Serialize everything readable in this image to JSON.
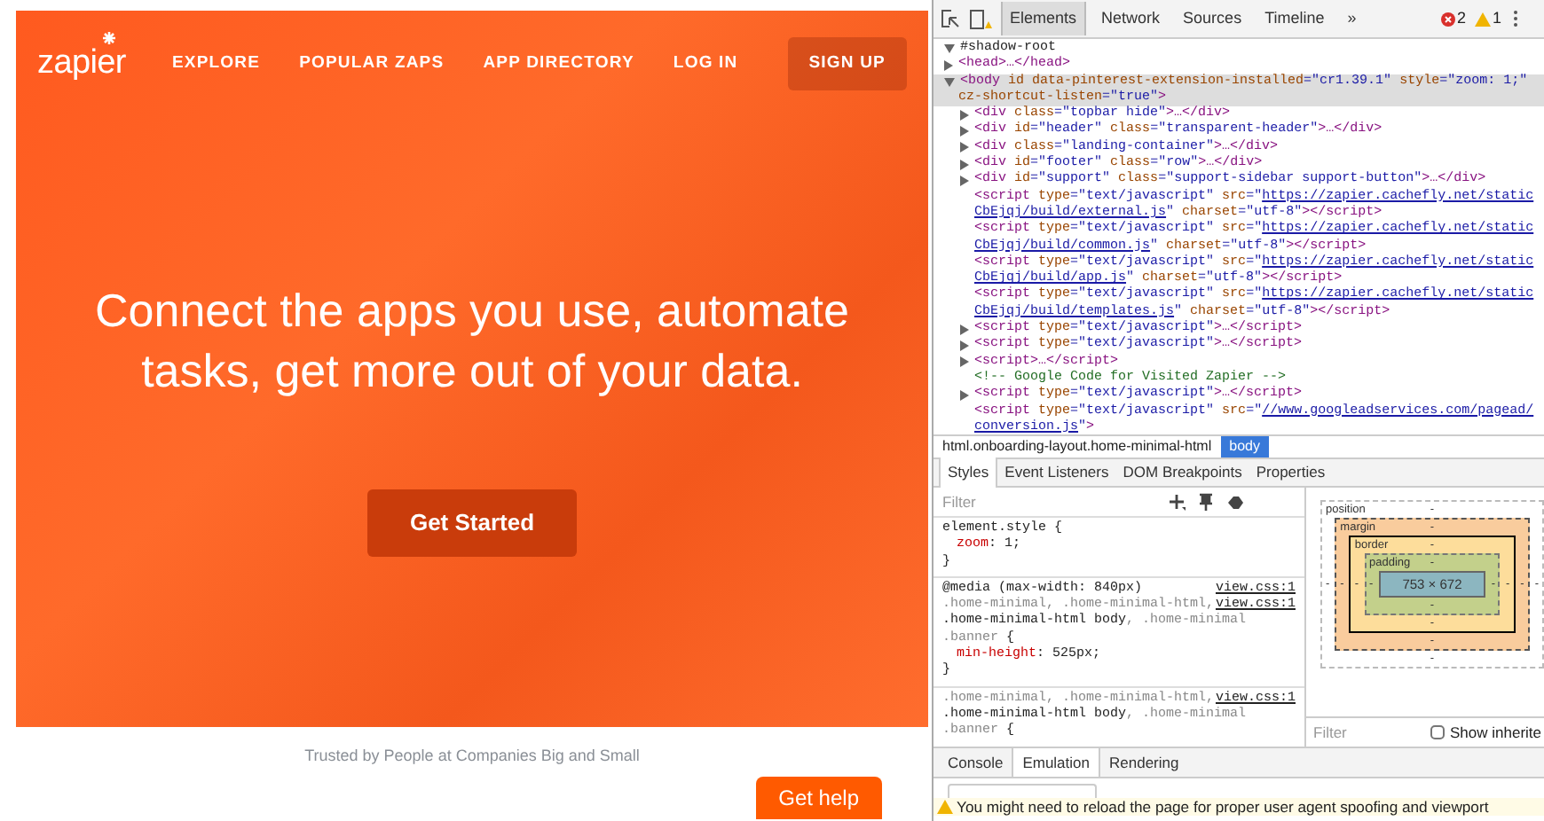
{
  "page": {
    "logo": "zapier",
    "nav": [
      {
        "label": "EXPLORE",
        "kind": "link"
      },
      {
        "label": "POPULAR ZAPS",
        "kind": "link"
      },
      {
        "label": "APP DIRECTORY",
        "kind": "link"
      },
      {
        "label": "LOG IN",
        "kind": "link"
      },
      {
        "label": "SIGN UP",
        "kind": "button"
      }
    ],
    "headline": "Connect the apps you use, automate tasks, get more out of your data.",
    "cta": "Get Started",
    "tagline": "Trusted by People at Companies Big and Small",
    "help_button": "Get help"
  },
  "devtools": {
    "toolbar": {
      "tabs": [
        {
          "label": "Elements",
          "selected": true
        },
        {
          "label": "Network",
          "selected": false
        },
        {
          "label": "Sources",
          "selected": false
        },
        {
          "label": "Timeline",
          "selected": false
        }
      ],
      "more": "»",
      "errors": "2",
      "warnings": "1"
    },
    "dom": [
      {
        "expanded": true,
        "selected": false,
        "lines": [
          [
            {
              "kind": "plain",
              "text": "#shadow-root"
            }
          ]
        ]
      },
      {
        "expanded": false,
        "selected": false,
        "lines": [
          [
            {
              "kind": "tag",
              "text": "<head>…</head>"
            }
          ]
        ]
      },
      {
        "expanded": true,
        "selected": true,
        "lines": [
          [
            {
              "kind": "tag",
              "text": "<body"
            },
            {
              "kind": "attr",
              "text": " id data-pinterest-extension-installed"
            },
            {
              "kind": "value",
              "text": "=\"cr1.39.1\""
            },
            {
              "kind": "attr",
              "text": " style"
            },
            {
              "kind": "value",
              "text": "=\"zoom: 1;\""
            }
          ],
          [
            {
              "kind": "attr",
              "text": "cz-shortcut-listen"
            },
            {
              "kind": "value",
              "text": "=\"true\""
            },
            {
              "kind": "tag",
              "text": ">"
            }
          ]
        ],
        "children": [
          {
            "expanded": false,
            "selected": false,
            "lines": [
              [
                {
                  "kind": "tag",
                  "text": "<div"
                },
                {
                  "kind": "attr",
                  "text": " class"
                },
                {
                  "kind": "value",
                  "text": "=\"topbar hide\""
                },
                {
                  "kind": "tag",
                  "text": ">…</div>"
                }
              ]
            ]
          },
          {
            "expanded": false,
            "selected": false,
            "lines": [
              [
                {
                  "kind": "tag",
                  "text": "<div"
                },
                {
                  "kind": "attr",
                  "text": " id"
                },
                {
                  "kind": "value",
                  "text": "=\"header\""
                },
                {
                  "kind": "attr",
                  "text": " class"
                },
                {
                  "kind": "value",
                  "text": "=\"transparent-header\""
                },
                {
                  "kind": "tag",
                  "text": ">…</div>"
                }
              ]
            ]
          },
          {
            "expanded": false,
            "selected": false,
            "lines": [
              [
                {
                  "kind": "tag",
                  "text": "<div"
                },
                {
                  "kind": "attr",
                  "text": " class"
                },
                {
                  "kind": "value",
                  "text": "=\"landing-container\""
                },
                {
                  "kind": "tag",
                  "text": ">…</div>"
                }
              ]
            ]
          },
          {
            "expanded": false,
            "selected": false,
            "lines": [
              [
                {
                  "kind": "tag",
                  "text": "<div"
                },
                {
                  "kind": "attr",
                  "text": " id"
                },
                {
                  "kind": "value",
                  "text": "=\"footer\""
                },
                {
                  "kind": "attr",
                  "text": " class"
                },
                {
                  "kind": "value",
                  "text": "=\"row\""
                },
                {
                  "kind": "tag",
                  "text": ">…</div>"
                }
              ]
            ]
          },
          {
            "expanded": false,
            "selected": false,
            "lines": [
              [
                {
                  "kind": "tag",
                  "text": "<div"
                },
                {
                  "kind": "attr",
                  "text": " id"
                },
                {
                  "kind": "value",
                  "text": "=\"support\""
                },
                {
                  "kind": "attr",
                  "text": " class"
                },
                {
                  "kind": "value",
                  "text": "=\"support-sidebar support-button\""
                },
                {
                  "kind": "tag",
                  "text": ">…</div>"
                }
              ]
            ]
          },
          {
            "selected": false,
            "lines": [
              [
                {
                  "kind": "tag",
                  "text": "<script"
                },
                {
                  "kind": "attr",
                  "text": " type"
                },
                {
                  "kind": "value",
                  "text": "=\"text/javascript\""
                },
                {
                  "kind": "attr",
                  "text": " src"
                },
                {
                  "kind": "value",
                  "text": "=\""
                },
                {
                  "kind": "link",
                  "text": "https://zapier.cachefly.net/static"
                }
              ],
              [
                {
                  "kind": "link",
                  "text": "CbEjqj/build/external.js"
                },
                {
                  "kind": "value",
                  "text": "\""
                },
                {
                  "kind": "attr",
                  "text": " charset"
                },
                {
                  "kind": "value",
                  "text": "=\"utf-8\""
                },
                {
                  "kind": "tag",
                  "text": "></script>"
                }
              ]
            ]
          },
          {
            "selected": false,
            "lines": [
              [
                {
                  "kind": "tag",
                  "text": "<script"
                },
                {
                  "kind": "attr",
                  "text": " type"
                },
                {
                  "kind": "value",
                  "text": "=\"text/javascript\""
                },
                {
                  "kind": "attr",
                  "text": " src"
                },
                {
                  "kind": "value",
                  "text": "=\""
                },
                {
                  "kind": "link",
                  "text": "https://zapier.cachefly.net/static"
                }
              ],
              [
                {
                  "kind": "link",
                  "text": "CbEjqj/build/common.js"
                },
                {
                  "kind": "value",
                  "text": "\""
                },
                {
                  "kind": "attr",
                  "text": " charset"
                },
                {
                  "kind": "value",
                  "text": "=\"utf-8\""
                },
                {
                  "kind": "tag",
                  "text": "></script>"
                }
              ]
            ]
          },
          {
            "selected": false,
            "lines": [
              [
                {
                  "kind": "tag",
                  "text": "<script"
                },
                {
                  "kind": "attr",
                  "text": " type"
                },
                {
                  "kind": "value",
                  "text": "=\"text/javascript\""
                },
                {
                  "kind": "attr",
                  "text": " src"
                },
                {
                  "kind": "value",
                  "text": "=\""
                },
                {
                  "kind": "link",
                  "text": "https://zapier.cachefly.net/static"
                }
              ],
              [
                {
                  "kind": "link",
                  "text": "CbEjqj/build/app.js"
                },
                {
                  "kind": "value",
                  "text": "\""
                },
                {
                  "kind": "attr",
                  "text": " charset"
                },
                {
                  "kind": "value",
                  "text": "=\"utf-8\""
                },
                {
                  "kind": "tag",
                  "text": "></script>"
                }
              ]
            ]
          },
          {
            "selected": false,
            "lines": [
              [
                {
                  "kind": "tag",
                  "text": "<script"
                },
                {
                  "kind": "attr",
                  "text": " type"
                },
                {
                  "kind": "value",
                  "text": "=\"text/javascript\""
                },
                {
                  "kind": "attr",
                  "text": " src"
                },
                {
                  "kind": "value",
                  "text": "=\""
                },
                {
                  "kind": "link",
                  "text": "https://zapier.cachefly.net/static"
                }
              ],
              [
                {
                  "kind": "link",
                  "text": "CbEjqj/build/templates.js"
                },
                {
                  "kind": "value",
                  "text": "\""
                },
                {
                  "kind": "attr",
                  "text": " charset"
                },
                {
                  "kind": "value",
                  "text": "=\"utf-8\""
                },
                {
                  "kind": "tag",
                  "text": "></script>"
                }
              ]
            ]
          },
          {
            "expanded": false,
            "selected": false,
            "lines": [
              [
                {
                  "kind": "tag",
                  "text": "<script"
                },
                {
                  "kind": "attr",
                  "text": " type"
                },
                {
                  "kind": "value",
                  "text": "=\"text/javascript\""
                },
                {
                  "kind": "tag",
                  "text": ">…</script>"
                }
              ]
            ]
          },
          {
            "expanded": false,
            "selected": false,
            "lines": [
              [
                {
                  "kind": "tag",
                  "text": "<script"
                },
                {
                  "kind": "attr",
                  "text": " type"
                },
                {
                  "kind": "value",
                  "text": "=\"text/javascript\""
                },
                {
                  "kind": "tag",
                  "text": ">…</script>"
                }
              ]
            ]
          },
          {
            "expanded": false,
            "selected": false,
            "lines": [
              [
                {
                  "kind": "tag",
                  "text": "<script>…</script>"
                }
              ]
            ]
          },
          {
            "selected": false,
            "lines": [
              [
                {
                  "kind": "comment",
                  "text": "<!-- Google Code for Visited Zapier -->"
                }
              ]
            ]
          },
          {
            "expanded": false,
            "selected": false,
            "lines": [
              [
                {
                  "kind": "tag",
                  "text": "<script"
                },
                {
                  "kind": "attr",
                  "text": " type"
                },
                {
                  "kind": "value",
                  "text": "=\"text/javascript\""
                },
                {
                  "kind": "tag",
                  "text": ">…</script>"
                }
              ]
            ]
          },
          {
            "selected": false,
            "lines": [
              [
                {
                  "kind": "tag",
                  "text": "<script"
                },
                {
                  "kind": "attr",
                  "text": " type"
                },
                {
                  "kind": "value",
                  "text": "=\"text/javascript\""
                },
                {
                  "kind": "attr",
                  "text": " src"
                },
                {
                  "kind": "value",
                  "text": "=\""
                },
                {
                  "kind": "link",
                  "text": "//www.googleadservices.com/pagead/"
                }
              ],
              [
                {
                  "kind": "link",
                  "text": "conversion.js"
                },
                {
                  "kind": "value",
                  "text": "\""
                },
                {
                  "kind": "tag",
                  "text": ">"
                }
              ]
            ]
          }
        ]
      }
    ],
    "breadcrumbs": [
      {
        "label": "html.onboarding-layout.home-minimal-html",
        "selected": false
      },
      {
        "label": "body",
        "selected": true
      }
    ],
    "sidebar_tabs": [
      {
        "label": "Styles",
        "selected": true
      },
      {
        "label": "Event Listeners",
        "selected": false
      },
      {
        "label": "DOM Breakpoints",
        "selected": false
      },
      {
        "label": "Properties",
        "selected": false
      }
    ],
    "styles": {
      "filter_placeholder": "Filter",
      "rules": [
        {
          "lines": [
            {
              "tokens": [
                {
                  "kind": "sel",
                  "text": "element.style {"
                }
              ]
            },
            {
              "tokens": [
                {
                  "kind": "prop",
                  "text": "zoom"
                },
                {
                  "kind": "plain",
                  "text": ": 1;"
                }
              ],
              "indent": true
            },
            {
              "tokens": [
                {
                  "kind": "sel",
                  "text": "}"
                }
              ]
            }
          ]
        },
        {
          "lines": [
            {
              "tokens": [
                {
                  "kind": "sel",
                  "text": "@media (max-width: 840px)"
                }
              ],
              "source": "view.css:1"
            },
            {
              "tokens": [
                {
                  "kind": "dim",
                  "text": ".home-minimal, .home-minimal-html,"
                }
              ],
              "source": "view.css:1"
            },
            {
              "tokens": [
                {
                  "kind": "sel",
                  "text": ".home-minimal-html body"
                },
                {
                  "kind": "dim",
                  "text": ", .home-minimal"
                }
              ]
            },
            {
              "tokens": [
                {
                  "kind": "dim",
                  "text": ".banner"
                },
                {
                  "kind": "sel",
                  "text": " {"
                }
              ]
            },
            {
              "tokens": [
                {
                  "kind": "prop",
                  "text": "min-height"
                },
                {
                  "kind": "plain",
                  "text": ": 525px;"
                }
              ],
              "indent": true
            },
            {
              "tokens": [
                {
                  "kind": "sel",
                  "text": "}"
                }
              ]
            }
          ]
        },
        {
          "lines": [
            {
              "tokens": [
                {
                  "kind": "dim",
                  "text": ".home-minimal, .home-minimal-html,"
                }
              ],
              "source": "view.css:1"
            },
            {
              "tokens": [
                {
                  "kind": "sel",
                  "text": ".home-minimal-html body"
                },
                {
                  "kind": "dim",
                  "text": ", .home-minimal"
                }
              ]
            },
            {
              "tokens": [
                {
                  "kind": "dim",
                  "text": ".banner"
                },
                {
                  "kind": "sel",
                  "text": " {"
                }
              ]
            }
          ]
        }
      ]
    },
    "box_model": {
      "layers": [
        {
          "label": "position",
          "top": "-",
          "left": "-"
        },
        {
          "label": "margin",
          "top": "-",
          "left": "-"
        },
        {
          "label": "border",
          "top": "-",
          "left": "-"
        },
        {
          "label": "padding",
          "top": "-",
          "left": "-"
        }
      ],
      "content": "753 × 672",
      "trailing_values": [
        "-",
        "-",
        "-",
        "-"
      ],
      "lower_values": [
        "-",
        "-",
        "-",
        "-"
      ]
    },
    "computed": {
      "filter_placeholder": "Filter",
      "show_inherited": {
        "label": "Show inherite",
        "checked": false
      }
    },
    "drawer_tabs": [
      {
        "label": "Console",
        "selected": false
      },
      {
        "label": "Emulation",
        "selected": true
      },
      {
        "label": "Rendering",
        "selected": false
      }
    ],
    "emulation": {
      "warning": "You might need to reload the page for proper user agent spoofing and viewport"
    }
  }
}
